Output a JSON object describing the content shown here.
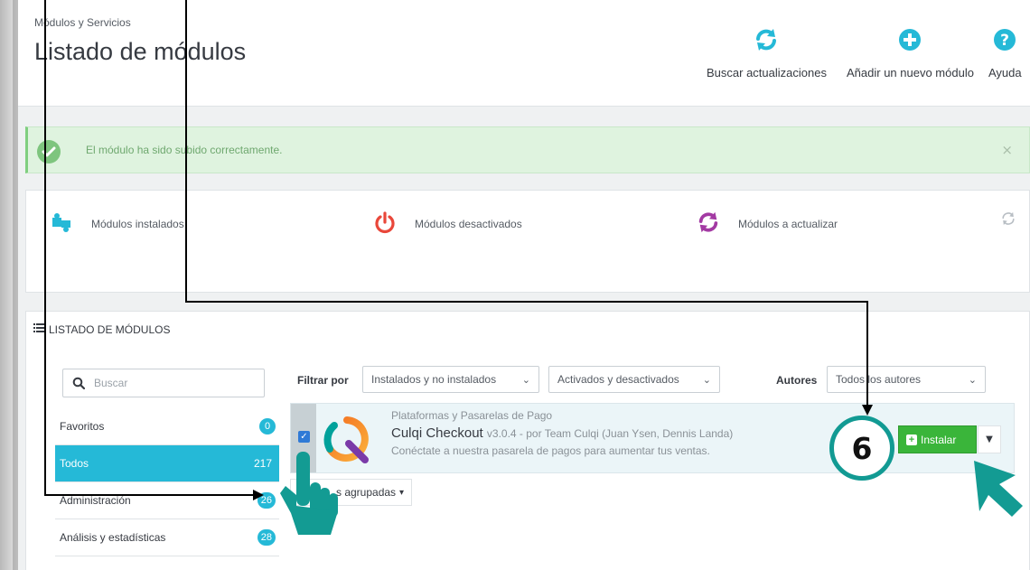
{
  "header": {
    "breadcrumb": "Módulos y Servicios",
    "title": "Listado de módulos",
    "actions": [
      {
        "label": "Buscar actualizaciones",
        "icon": "refresh-icon"
      },
      {
        "label": "Añadir un nuevo módulo",
        "icon": "plus-circle-icon"
      },
      {
        "label": "Ayuda",
        "icon": "help-icon"
      }
    ]
  },
  "alert": {
    "message": "El módulo ha sido subido correctamente.",
    "close": "×"
  },
  "kpis": [
    {
      "label": "Módulos instalados",
      "icon": "puzzle-icon"
    },
    {
      "label": "Módulos desactivados",
      "icon": "power-icon"
    },
    {
      "label": "Módulos a actualizar",
      "icon": "update-icon"
    }
  ],
  "list": {
    "title": "LISTADO DE MÓDULOS",
    "search_placeholder": "Buscar",
    "categories": [
      {
        "label": "Favoritos",
        "count": "0"
      },
      {
        "label": "Todos",
        "count": "217"
      },
      {
        "label": "Administración",
        "count": "26"
      },
      {
        "label": "Análisis y estadísticas",
        "count": "28"
      }
    ],
    "filter_label": "Filtrar por",
    "filter_install": "Instalados y no instalados",
    "filter_status": "Activados y desactivados",
    "authors_label": "Autores",
    "authors_value": "Todos los autores",
    "group_action": "s agrupadas",
    "group_caret": "▾"
  },
  "module": {
    "category": "Plataformas y Pasarelas de Pago",
    "name": "Culqi Checkout",
    "meta": "v3.0.4 - por Team Culqi (Juan Ysen, Dennis Landa)",
    "description": "Conéctate a nuestra pasarela de pagos para aumentar tus ventas.",
    "install_label": "Instalar",
    "checked": true
  },
  "annotation": {
    "step": "6"
  },
  "colors": {
    "accent": "#25b9d7",
    "success": "#3ab53a",
    "annotation": "#129a93",
    "power": "#e9473a",
    "update": "#a33aa3"
  }
}
